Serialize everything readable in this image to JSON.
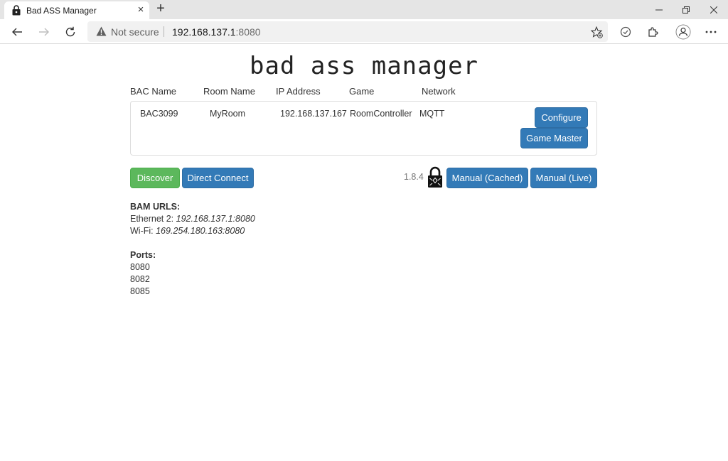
{
  "browser": {
    "tab_title": "Bad ASS Manager",
    "tab_close_glyph": "×",
    "new_tab_glyph": "+",
    "security_label": "Not secure",
    "url_host": "192.168.137.1",
    "url_port": ":8080",
    "icons": [
      "lock-favicon-icon",
      "close-icon",
      "plus-icon",
      "minimize-icon",
      "restore-icon",
      "close-window-icon",
      "back-icon",
      "forward-icon",
      "refresh-icon",
      "warning-icon",
      "favorite-star-icon",
      "check-circle-icon",
      "extensions-icon",
      "profile-icon",
      "more-icon"
    ]
  },
  "page": {
    "logo": "bad ass manager",
    "columns": [
      "BAC Name",
      "Room Name",
      "IP Address",
      "Game",
      "Network"
    ],
    "bacs": [
      {
        "name": "BAC3099",
        "room": "MyRoom",
        "ip": "192.168.137.167",
        "game": "RoomController",
        "network": "MQTT",
        "configure_label": "Configure",
        "game_master_label": "Game Master"
      }
    ],
    "discover_label": "Discover",
    "direct_connect_label": "Direct Connect",
    "version": "1.8.4",
    "manual_cached_label": "Manual (Cached)",
    "manual_live_label": "Manual (Live)",
    "bam_urls_title": "BAM URLS:",
    "urls": [
      {
        "label": "Ethernet 2:",
        "value": "192.168.137.1:8080"
      },
      {
        "label": "Wi-Fi:",
        "value": "169.254.180.163:8080"
      }
    ],
    "ports_title": "Ports:",
    "ports": [
      "8080",
      "8082",
      "8085"
    ]
  },
  "colors": {
    "primary": "#337ab7",
    "success": "#5cb85c",
    "chrome_bg": "#e5e5e5"
  }
}
